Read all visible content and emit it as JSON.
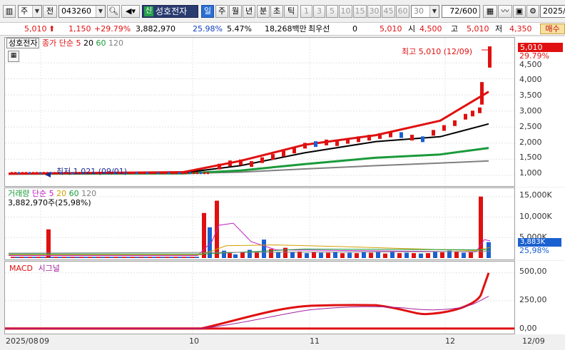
{
  "toolbar": {
    "period_type": "주",
    "mode_button": "전",
    "stock_code": "043260",
    "stock_badge": "신",
    "stock_name": "성호전자",
    "period_tabs": [
      "일",
      "주",
      "월",
      "년",
      "분",
      "초",
      "틱"
    ],
    "active_period": "일",
    "minute_buttons": [
      "1",
      "3",
      "5",
      "10",
      "15",
      "30",
      "45",
      "60"
    ],
    "interval_value": "30",
    "count_display": "72",
    "count_total": "/600",
    "date_value": "2025/"
  },
  "quote": {
    "price": "5,010",
    "change": "1,150",
    "change_pct": "+29.79%",
    "volume": "3,882,970",
    "turnover_pct": "25.98%",
    "vol_ratio": "5.47%",
    "amount": "18,268백만",
    "best_label": "최우선",
    "best_value": "0",
    "best_price": "5,010",
    "open_label": "시",
    "open": "4,500",
    "high_label": "고",
    "high": "5,010",
    "low_label": "저",
    "low": "4,350",
    "buy_label": "매수"
  },
  "price_panel": {
    "stock_label": "성호전자",
    "legend_title": "종가 단순",
    "ma_periods": [
      "5",
      "20",
      "60",
      "120"
    ],
    "ma_colors": [
      "#e01010",
      "#000000",
      "#1a9a3a",
      "#808080"
    ],
    "high_annotation": "최고 5,010 (12/09)",
    "low_annotation": "최저 1,021 (09/01)",
    "last_price_tag": "5,010",
    "last_pct_tag": "29.79%",
    "y_labels": [
      "4,500",
      "4,000",
      "3,500",
      "3,000",
      "2,500",
      "2,000",
      "1,500",
      "1,000"
    ]
  },
  "volume_panel": {
    "title": "거래량",
    "legend_title": "단순",
    "ma_periods": [
      "5",
      "20",
      "60",
      "120"
    ],
    "current_value": "3,882,970주(25,98%)",
    "last_tag": "3,883K",
    "last_pct": "25,98%",
    "y_labels": [
      "15,000K",
      "10,000K",
      "5,000K"
    ]
  },
  "macd_panel": {
    "title": "MACD",
    "signal_label": "시그널",
    "y_labels": [
      "500,00",
      "250,00",
      "0,00"
    ]
  },
  "x_axis": {
    "labels": [
      "2025/08",
      "09",
      "10",
      "11",
      "12",
      "12/09"
    ]
  },
  "chart_data": [
    {
      "type": "line",
      "title": "성호전자 종가 단순",
      "x": [
        "2025/09",
        "2025/10 early",
        "2025/10 late",
        "2025/11 early",
        "2025/11 late",
        "2025/12 early",
        "2025/12/09"
      ],
      "series": [
        {
          "name": "5",
          "values": [
            1050,
            1100,
            1450,
            1950,
            2250,
            2700,
            3600
          ]
        },
        {
          "name": "20",
          "values": [
            1050,
            1080,
            1300,
            1700,
            2050,
            2200,
            2600
          ]
        },
        {
          "name": "60",
          "values": [
            1050,
            1060,
            1150,
            1350,
            1550,
            1650,
            1850
          ]
        },
        {
          "name": "120",
          "values": [
            1060,
            1060,
            1100,
            1200,
            1300,
            1380,
            1450
          ]
        }
      ],
      "annotations": [
        "최고 5,010 (12/09)",
        "최저 1,021 (09/01)"
      ],
      "ylim": [
        800,
        5100
      ]
    },
    {
      "type": "bar",
      "title": "거래량",
      "categories": [
        "09 early",
        "10 start",
        "10 spike 1",
        "10 spike 2",
        "11",
        "12/08",
        "12/09"
      ],
      "values": [
        7000,
        11000,
        7500,
        14000,
        2000,
        15000,
        3883
      ],
      "ylim": [
        0,
        16000
      ]
    },
    {
      "type": "line",
      "title": "MACD",
      "x": [
        "2025/09",
        "2025/10",
        "2025/11 early",
        "2025/11 late",
        "2025/12 early",
        "2025/12/09"
      ],
      "series": [
        {
          "name": "MACD",
          "values": [
            0,
            5,
            200,
            210,
            130,
            500
          ]
        },
        {
          "name": "시그널",
          "values": [
            0,
            2,
            160,
            205,
            150,
            290
          ]
        }
      ],
      "ylim": [
        -20,
        550
      ]
    }
  ]
}
